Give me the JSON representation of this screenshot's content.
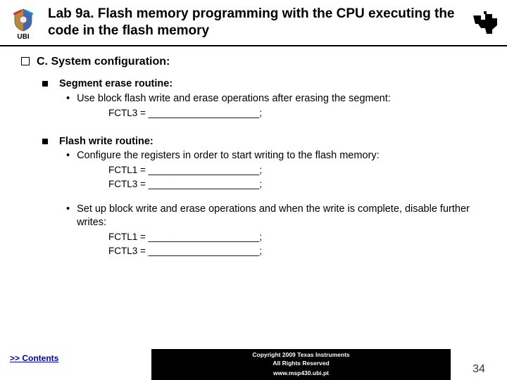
{
  "header": {
    "ubi_label": "UBI",
    "title": "Lab 9a. Flash memory programming with the CPU executing the code in the flash memory"
  },
  "section": {
    "title": "C. System configuration:",
    "subsections": [
      {
        "title": "Segment erase routine:",
        "points": [
          {
            "text": "Use block flash write and erase operations after erasing the segment:",
            "code": [
              "FCTL3 = _____________________;"
            ]
          }
        ]
      },
      {
        "title": "Flash write routine:",
        "points": [
          {
            "text": "Configure the registers in order to start writing to the flash memory:",
            "code": [
              "FCTL1 = _____________________;",
              "FCTL3 = _____________________;"
            ]
          },
          {
            "text": "Set up block write and erase operations and when the write is complete, disable further writes:",
            "code": [
              "FCTL1 = _____________________;",
              "FCTL3 = _____________________;"
            ]
          }
        ]
      }
    ]
  },
  "footer": {
    "contents_link": ">> Contents",
    "copyright_line1": "Copyright  2009 Texas Instruments",
    "copyright_line2": "All Rights Reserved",
    "copyright_line3": "www.msp430.ubi.pt",
    "slide_number": "34"
  }
}
